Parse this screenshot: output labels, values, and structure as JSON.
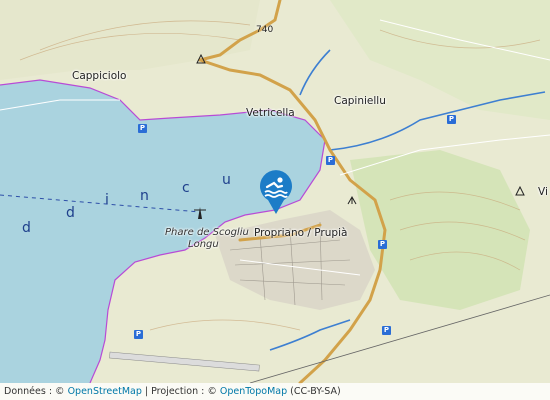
{
  "map": {
    "places": {
      "cappiciolo": "Cappiciolo",
      "vetricella": "Vetricella",
      "capiniellu": "Capiniellu",
      "propriano": "Propriano / Prupià",
      "phare_line1": "Phare de Scogliu",
      "phare_line2": "Longu",
      "v_partial": "Vi"
    },
    "road_numbers": {
      "top": "740"
    },
    "water_letters": [
      "d",
      "d",
      "i",
      "n",
      "c",
      "u"
    ],
    "parking_label": "P",
    "marker_icon": "swimmer-icon",
    "colors": {
      "sea": "#aad3df",
      "land": "#e9ead2",
      "forest": "#cfe2b2",
      "road_main": "#d2a24a",
      "river": "#3d7fd1",
      "marker": "#1c7cc7",
      "coastline": "#b84bd6"
    }
  },
  "attribution": {
    "prefix": "Données : © ",
    "osm": "OpenStreetMap",
    "mid": " | Projection : © ",
    "otm": "OpenTopoMap",
    "license": " (CC-BY-SA)"
  }
}
